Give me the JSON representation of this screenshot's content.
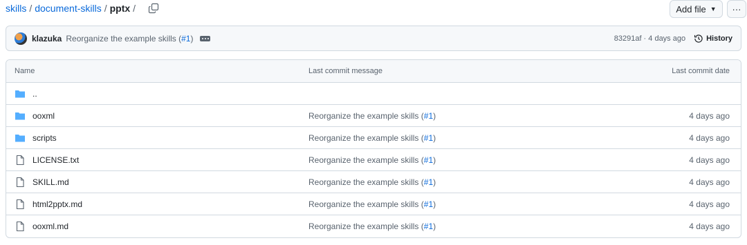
{
  "breadcrumb": {
    "repo": "skills",
    "folder": "document-skills",
    "current": "pptx",
    "separator": "/"
  },
  "actions": {
    "add_file": "Add file",
    "more": "···"
  },
  "latest_commit": {
    "author": "klazuka",
    "message": "Reorganize the example skills",
    "pr_link": "#1",
    "sha_age": "83291af · 4 days ago",
    "history": "History"
  },
  "table": {
    "headers": {
      "name": "Name",
      "message": "Last commit message",
      "date": "Last commit date"
    },
    "parent": "..",
    "rows": [
      {
        "name": "ooxml",
        "type": "folder",
        "message": "Reorganize the example skills",
        "pr": "#1",
        "date": "4 days ago"
      },
      {
        "name": "scripts",
        "type": "folder",
        "message": "Reorganize the example skills",
        "pr": "#1",
        "date": "4 days ago"
      },
      {
        "name": "LICENSE.txt",
        "type": "file",
        "message": "Reorganize the example skills",
        "pr": "#1",
        "date": "4 days ago"
      },
      {
        "name": "SKILL.md",
        "type": "file",
        "message": "Reorganize the example skills",
        "pr": "#1",
        "date": "4 days ago"
      },
      {
        "name": "html2pptx.md",
        "type": "file",
        "message": "Reorganize the example skills",
        "pr": "#1",
        "date": "4 days ago"
      },
      {
        "name": "ooxml.md",
        "type": "file",
        "message": "Reorganize the example skills",
        "pr": "#1",
        "date": "4 days ago"
      }
    ]
  },
  "colors": {
    "link": "#0969da",
    "folder": "#54aeff",
    "muted": "#59636e",
    "border": "#d1d9e0"
  }
}
